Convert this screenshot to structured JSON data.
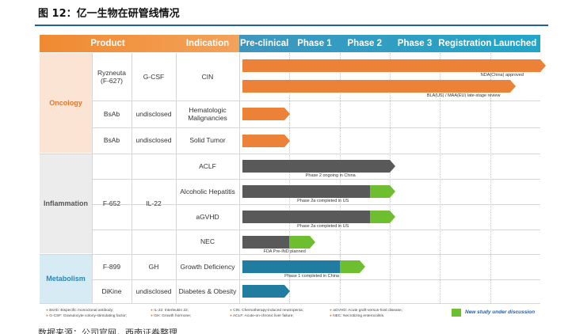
{
  "figure_title": "图 12：亿一生物在研管线情况",
  "header": {
    "product": "Product",
    "indication": "Indication",
    "stages": [
      "Pre-clinical",
      "Phase 1",
      "Phase 2",
      "Phase 3",
      "Registration",
      "Launched"
    ]
  },
  "areas": {
    "oncology": "Oncology",
    "inflammation": "Inflammation",
    "metabolism": "Metabolism"
  },
  "rows": [
    {
      "product": "Ryzneuta\n(F-627)",
      "target": "G-CSF",
      "indication": "CIN",
      "bars": [
        {
          "kind": "orange",
          "end": 6.0,
          "note": "NDA(China) approved"
        },
        {
          "kind": "orange",
          "end": 5.4,
          "note": "BLA(US) / MAA(EU) late-stage review"
        }
      ]
    },
    {
      "product": "BsAb",
      "target": "undisclosed",
      "indication": "Hematologic\nMalignancies",
      "bars": [
        {
          "kind": "orange",
          "end": 0.9
        }
      ]
    },
    {
      "product": "BsAb",
      "target": "undisclosed",
      "indication": "Solid Tumor",
      "bars": [
        {
          "kind": "orange",
          "end": 0.9
        }
      ]
    },
    {
      "product": "F-652",
      "target": "IL-22",
      "indication": "ACLF",
      "bars": [
        {
          "kind": "gray",
          "end": 3.0,
          "note": "Phase 2 ongoing in China"
        }
      ]
    },
    {
      "product": "",
      "target": "",
      "indication": "Alcoholic Hepatitis",
      "bars": [
        {
          "kind": "gray",
          "end": 2.6,
          "green_end": 3.0,
          "note": "Phase 2a completed in US"
        }
      ]
    },
    {
      "product": "",
      "target": "",
      "indication": "aGVHD",
      "bars": [
        {
          "kind": "gray",
          "end": 2.6,
          "green_end": 3.0,
          "note": "Phase 2a completed in US"
        }
      ]
    },
    {
      "product": "",
      "target": "",
      "indication": "NEC",
      "bars": [
        {
          "kind": "gray",
          "end": 1.0,
          "green_end": 1.4,
          "note": "FDA Pre-IND planned"
        }
      ]
    },
    {
      "product": "F-899",
      "target": "GH",
      "indication": "Growth Deficiency",
      "bars": [
        {
          "kind": "teal",
          "end": 2.0,
          "green_end": 2.4,
          "note": "Phase 1 completed in China"
        }
      ]
    },
    {
      "product": "DiKine",
      "target": "undisclosed",
      "indication": "Diabetes & Obesity",
      "bars": [
        {
          "kind": "teal",
          "end": 0.9
        }
      ]
    }
  ],
  "footnotes": {
    "col1": [
      "BsAb: Bispecific monoclonal antibody;",
      "G-CSF: Granulocyte colony-stimulating factor;"
    ],
    "col2": [
      "IL-22: Interleukin 22;",
      "GH: Growth hormone;"
    ],
    "col3": [
      "CIN: Chemotherapy-induced neutropenia;",
      "ACLF: Acute-on-chronic liver failure;"
    ],
    "col4": [
      "aGVHD: Acute graft-versus-host disease;",
      "NEC: Necrotizing enterocolitis."
    ]
  },
  "legend": "New study under discussion",
  "colors": {
    "orange": "#ec8238",
    "gray": "#595959",
    "teal": "#207ca0",
    "green": "#6ebf2f",
    "blue_header": "#2aa2c8"
  },
  "source": "数据来源：公司官网，西南证券整理"
}
